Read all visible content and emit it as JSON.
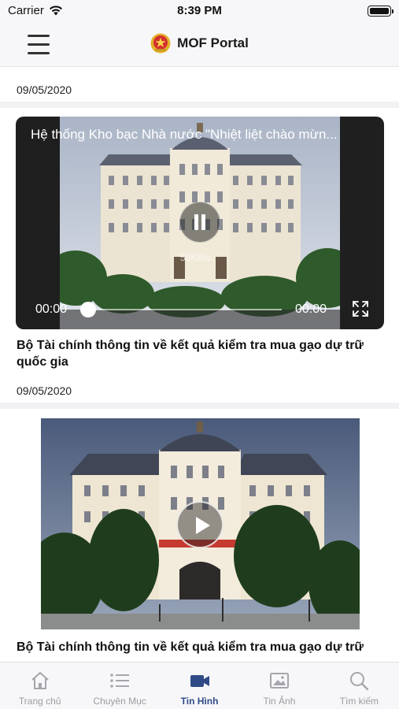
{
  "status_bar": {
    "carrier": "Carrier",
    "time": "8:39 PM"
  },
  "header": {
    "title": "MOF Portal",
    "menu_icon": "hamburger-icon",
    "logo_icon": "state-emblem-icon"
  },
  "feed": {
    "items": [
      {
        "date": "09/05/2020",
        "video": {
          "title": "Hệ thống Kho bạc Nhà nước \"Nhiệt liệt chào mừn...",
          "speed": "50KB/s",
          "current_time": "00:00",
          "duration": "00:00",
          "progress": 0,
          "state": "playing"
        },
        "headline": "Bộ Tài chính thông tin về kết quả kiểm tra mua gạo dự trữ quốc gia"
      },
      {
        "date": "09/05/2020",
        "thumbnail": {
          "icon": "play-icon"
        },
        "headline": "Bộ Tài chính thông tin về kết quả kiểm tra mua gạo dự trữ quốc gia"
      }
    ]
  },
  "tabs": [
    {
      "label": "Trang chủ",
      "icon": "home-icon",
      "active": false
    },
    {
      "label": "Chuyên Mục",
      "icon": "list-icon",
      "active": false
    },
    {
      "label": "Tin Hình",
      "icon": "video-camera-icon",
      "active": true
    },
    {
      "label": "Tin Ảnh",
      "icon": "photo-icon",
      "active": false
    },
    {
      "label": "Tìm kiếm",
      "icon": "search-icon",
      "active": false
    }
  ],
  "colors": {
    "accent": "#2f4b87",
    "inactive": "#9a9aa2",
    "bar_background": "#f7f7f9"
  }
}
